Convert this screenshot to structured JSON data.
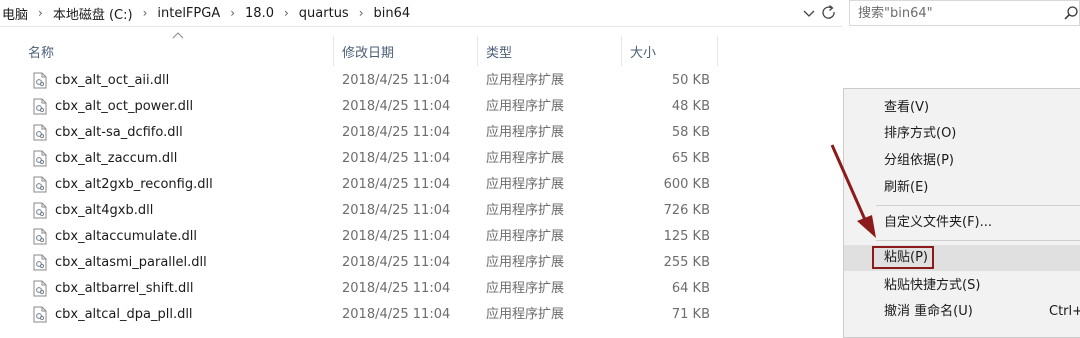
{
  "address_bar": {
    "crumbs": [
      "电脑",
      "本地磁盘 (C:)",
      "intelFPGA",
      "18.0",
      "quartus",
      "bin64"
    ]
  },
  "search": {
    "placeholder": "搜索\"bin64\""
  },
  "columns": {
    "name": "名称",
    "date": "修改日期",
    "type": "类型",
    "size": "大小"
  },
  "files": [
    {
      "name": "cbx_alt_oct_aii.dll",
      "date": "2018/4/25 11:04",
      "type": "应用程序扩展",
      "size": "50 KB"
    },
    {
      "name": "cbx_alt_oct_power.dll",
      "date": "2018/4/25 11:04",
      "type": "应用程序扩展",
      "size": "48 KB"
    },
    {
      "name": "cbx_alt-sa_dcfifo.dll",
      "date": "2018/4/25 11:04",
      "type": "应用程序扩展",
      "size": "58 KB"
    },
    {
      "name": "cbx_alt_zaccum.dll",
      "date": "2018/4/25 11:04",
      "type": "应用程序扩展",
      "size": "65 KB"
    },
    {
      "name": "cbx_alt2gxb_reconfig.dll",
      "date": "2018/4/25 11:04",
      "type": "应用程序扩展",
      "size": "600 KB"
    },
    {
      "name": "cbx_alt4gxb.dll",
      "date": "2018/4/25 11:04",
      "type": "应用程序扩展",
      "size": "726 KB"
    },
    {
      "name": "cbx_altaccumulate.dll",
      "date": "2018/4/25 11:04",
      "type": "应用程序扩展",
      "size": "125 KB"
    },
    {
      "name": "cbx_altasmi_parallel.dll",
      "date": "2018/4/25 11:04",
      "type": "应用程序扩展",
      "size": "255 KB"
    },
    {
      "name": "cbx_altbarrel_shift.dll",
      "date": "2018/4/25 11:04",
      "type": "应用程序扩展",
      "size": "64 KB"
    },
    {
      "name": "cbx_altcal_dpa_pll.dll",
      "date": "2018/4/25 11:04",
      "type": "应用程序扩展",
      "size": "71 KB"
    }
  ],
  "context_menu": {
    "view": "查看(V)",
    "sort": "排序方式(O)",
    "group": "分组依据(P)",
    "refresh": "刷新(E)",
    "customize": "自定义文件夹(F)...",
    "paste": "粘贴(P)",
    "paste_shortcut": "粘贴快捷方式(S)",
    "undo_rename": "撤消 重命名(U)",
    "undo_shortcut": "Ctrl+"
  },
  "colors": {
    "highlight_box": "#8b1a1a",
    "arrow": "#8b1a1a",
    "header_text": "#4c607a"
  },
  "icons": {
    "file": "dll-file-icon",
    "search": "search-icon",
    "refresh": "refresh-icon",
    "dropdown": "chevron-down-icon"
  }
}
